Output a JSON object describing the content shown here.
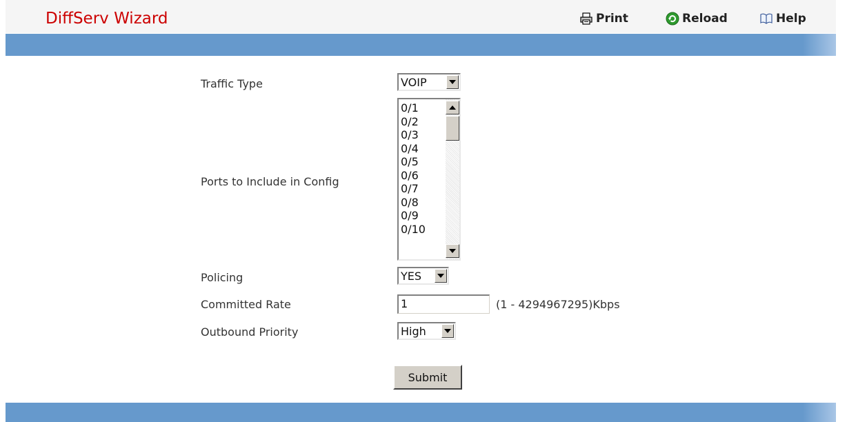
{
  "header": {
    "title": "DiffServ Wizard",
    "tools": {
      "print": {
        "label": "Print",
        "icon": "printer-icon"
      },
      "reload": {
        "label": "Reload",
        "icon": "reload-icon"
      },
      "help": {
        "label": "Help",
        "icon": "help-book-icon"
      }
    }
  },
  "colors": {
    "title": "#cc0000",
    "bar": "#6699cc",
    "header_bg": "#f5f5f5"
  },
  "form": {
    "traffic_type": {
      "label": "Traffic Type",
      "value": "VOIP"
    },
    "ports": {
      "label": "Ports to Include in Config",
      "options": [
        "0/1",
        "0/2",
        "0/3",
        "0/4",
        "0/5",
        "0/6",
        "0/7",
        "0/8",
        "0/9",
        "0/10"
      ]
    },
    "policing": {
      "label": "Policing",
      "value": "YES"
    },
    "committed_rate": {
      "label": "Committed Rate",
      "value": "1",
      "range": "(1 - 4294967295)Kbps"
    },
    "outbound_priority": {
      "label": "Outbound Priority",
      "value": "High"
    },
    "submit_label": "Submit"
  }
}
